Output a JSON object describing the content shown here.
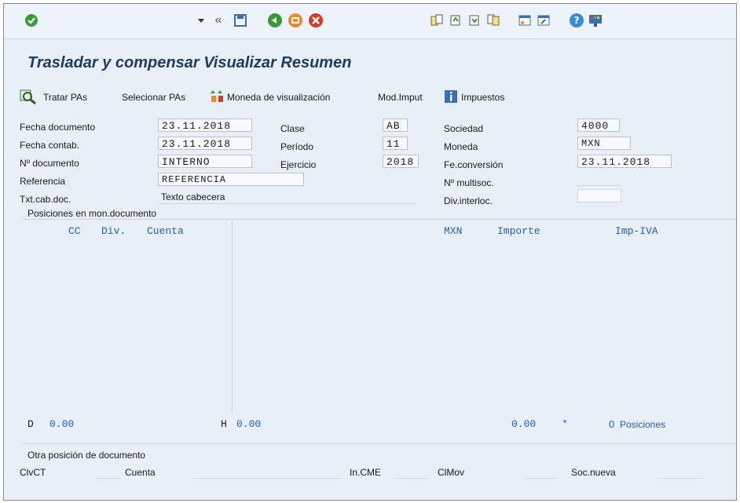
{
  "header": {
    "title": "Trasladar y compensar Visualizar Resumen"
  },
  "actions": {
    "tratar": "Tratar PAs",
    "seleccionar": "Selecionar PAs",
    "moneda": "Moneda de visualización",
    "modimput": "Mod.Imput",
    "impuestos": "Impuestos"
  },
  "form": {
    "fecha_documento": {
      "label": "Fecha documento",
      "value": "23.11.2018"
    },
    "fecha_contab": {
      "label": "Fecha contab.",
      "value": "23.11.2018"
    },
    "no_documento": {
      "label": "Nº documento",
      "value": "INTERNO"
    },
    "referencia": {
      "label": "Referencia",
      "value": "REFERENCIA"
    },
    "txt_cab": {
      "label": "Txt.cab.doc.",
      "value": "Texto cabecera"
    },
    "clase": {
      "label": "Clase",
      "value": "AB"
    },
    "periodo": {
      "label": "Período",
      "value": "11"
    },
    "ejercicio": {
      "label": "Ejercicio",
      "value": "2018"
    },
    "sociedad": {
      "label": "Sociedad",
      "value": "4000"
    },
    "moneda": {
      "label": "Moneda",
      "value": "MXN"
    },
    "fe_conversion": {
      "label": "Fe.conversión",
      "value": "23.11.2018"
    },
    "multisoc": {
      "label": "Nº multisoc.",
      "value": ""
    },
    "div_interloc": {
      "label": "Div.interloc.",
      "value": ""
    }
  },
  "positions": {
    "section_title": "Posiciones en mon.documento",
    "columns": {
      "cc": "CC",
      "div": "Div.",
      "cuenta": "Cuenta",
      "currency": "MXN",
      "importe": "Importe",
      "impiva": "Imp-IVA"
    }
  },
  "totals": {
    "d_label": "D",
    "d_value": "0.00",
    "h_label": "H",
    "h_value": "0.00",
    "balance": "0.00",
    "star": "*",
    "count": "0",
    "count_label": "Posiciones"
  },
  "other": {
    "section_title": "Otra posición de documento",
    "clvct": "ClvCT",
    "cuenta": "Cuenta",
    "incme": "In.CME",
    "clmov": "ClMov",
    "socnueva": "Soc.nueva"
  }
}
